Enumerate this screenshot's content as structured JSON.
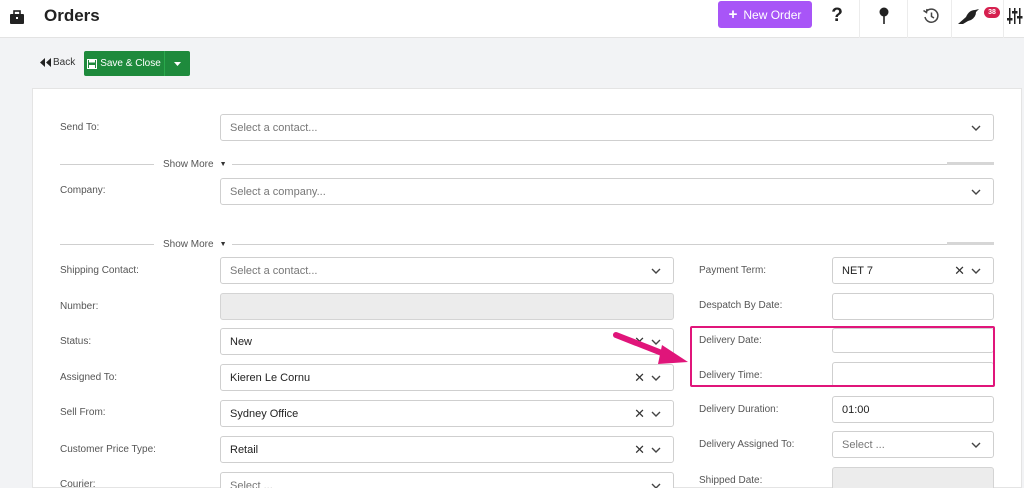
{
  "app": {
    "title": "Orders"
  },
  "header": {
    "new_order_label": "New Order",
    "help_icon": "question-icon",
    "pin_icon": "pin-icon",
    "history_icon": "history-icon",
    "notifications_icon": "bird-icon",
    "notification_count": "38",
    "settings_icon": "sliders-icon"
  },
  "toolbar": {
    "back_label": "Back",
    "save_close_label": "Save & Close"
  },
  "form": {
    "send_to": {
      "label": "Send To:",
      "placeholder": "Select a contact..."
    },
    "show_more_label": "Show More",
    "company": {
      "label": "Company:",
      "placeholder": "Select a company..."
    },
    "left": {
      "shipping_contact": {
        "label": "Shipping Contact:",
        "placeholder": "Select a contact..."
      },
      "number": {
        "label": "Number:",
        "value": ""
      },
      "status": {
        "label": "Status:",
        "value": "New"
      },
      "assigned_to": {
        "label": "Assigned To:",
        "value": "Kieren Le Cornu"
      },
      "sell_from": {
        "label": "Sell From:",
        "value": "Sydney Office"
      },
      "customer_price_type": {
        "label": "Customer Price Type:",
        "value": "Retail"
      },
      "courier": {
        "label": "Courier:",
        "placeholder": "Select ..."
      }
    },
    "right": {
      "payment_term": {
        "label": "Payment Term:",
        "value": "NET 7"
      },
      "despatch_by_date": {
        "label": "Despatch By Date:",
        "value": ""
      },
      "delivery_date": {
        "label": "Delivery Date:",
        "value": ""
      },
      "delivery_time": {
        "label": "Delivery Time:",
        "value": ""
      },
      "delivery_duration": {
        "label": "Delivery Duration:",
        "value": "01:00"
      },
      "delivery_assigned_to": {
        "label": "Delivery Assigned To:",
        "placeholder": "Select ..."
      },
      "shipped_date": {
        "label": "Shipped Date:",
        "value": ""
      }
    }
  },
  "colors": {
    "accent": "#a855f7",
    "save_green": "#1e8a3c",
    "highlight": "#e0157a",
    "badge": "#d6204f"
  }
}
